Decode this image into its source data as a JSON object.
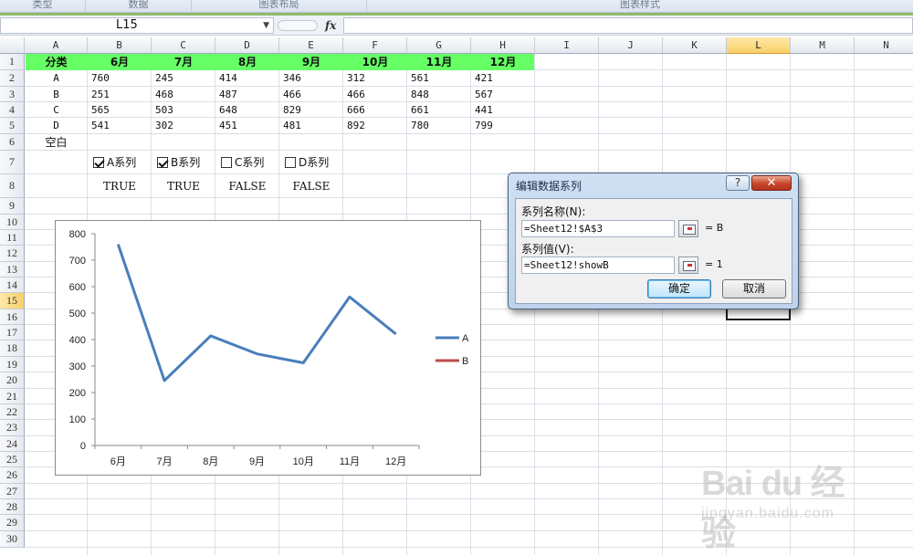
{
  "ribbon": {
    "groups": [
      "类型",
      "数据",
      "图表布局",
      "图表样式"
    ]
  },
  "formula_bar": {
    "name_box": "L15",
    "fx_label": "fx",
    "formula": ""
  },
  "sheet": {
    "columns": [
      "A",
      "B",
      "C",
      "D",
      "E",
      "F",
      "G",
      "H",
      "I",
      "J",
      "K",
      "L",
      "M",
      "N"
    ],
    "selected_column": "L",
    "rows": [
      "1",
      "2",
      "3",
      "4",
      "5",
      "6",
      "7",
      "8",
      "9",
      "10",
      "11",
      "12",
      "13",
      "14",
      "15",
      "16",
      "17",
      "18",
      "19",
      "20",
      "21",
      "22",
      "23",
      "24",
      "25",
      "26",
      "27",
      "28",
      "29",
      "30"
    ],
    "selected_row": "15",
    "header_row": [
      "分类",
      "6月",
      "7月",
      "8月",
      "9月",
      "10月",
      "11月",
      "12月"
    ],
    "data_rows": [
      [
        "A",
        "760",
        "245",
        "414",
        "346",
        "312",
        "561",
        "421"
      ],
      [
        "B",
        "251",
        "468",
        "487",
        "466",
        "466",
        "848",
        "567"
      ],
      [
        "C",
        "565",
        "503",
        "648",
        "829",
        "666",
        "661",
        "441"
      ],
      [
        "D",
        "541",
        "302",
        "451",
        "481",
        "892",
        "780",
        "799"
      ]
    ],
    "row6_label": "空白",
    "checkboxes": [
      {
        "label": "A系列",
        "checked": true
      },
      {
        "label": "B系列",
        "checked": true
      },
      {
        "label": "C系列",
        "checked": false
      },
      {
        "label": "D系列",
        "checked": false
      }
    ],
    "row8_values": [
      "TRUE",
      "TRUE",
      "FALSE",
      "FALSE"
    ]
  },
  "chart_data": {
    "type": "line",
    "categories": [
      "6月",
      "7月",
      "8月",
      "9月",
      "10月",
      "11月",
      "12月"
    ],
    "series": [
      {
        "name": "A",
        "values": [
          760,
          245,
          414,
          346,
          312,
          561,
          421
        ],
        "color": "#4a7ebb"
      },
      {
        "name": "B",
        "values": [],
        "color": "#be4b48"
      }
    ],
    "yticks": [
      "0",
      "100",
      "200",
      "300",
      "400",
      "500",
      "600",
      "700",
      "800"
    ],
    "ylim": [
      0,
      800
    ],
    "legend_position": "right",
    "title": "",
    "xlabel": "",
    "ylabel": ""
  },
  "dialog": {
    "title": "编辑数据系列",
    "help_label": "?",
    "close_label": "✕",
    "series_name_label": "系列名称(N):",
    "series_name_value": "=Sheet12!$A$3",
    "series_name_result": "= B",
    "series_values_label": "系列值(V):",
    "series_values_value": "=Sheet12!showB",
    "series_values_result": "= 1",
    "ok_label": "确定",
    "cancel_label": "取消"
  },
  "watermark": {
    "text": "Bai du 经验",
    "url": "jingyan.baidu.com"
  }
}
